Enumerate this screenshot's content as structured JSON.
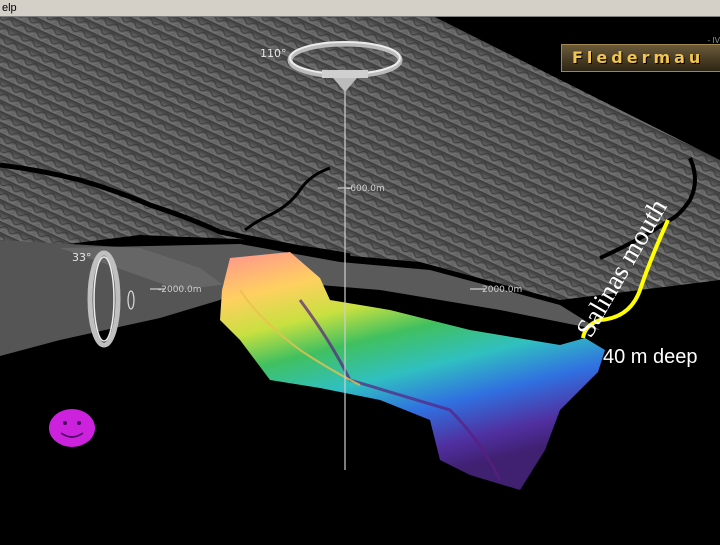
{
  "menu": {
    "help_label": "elp"
  },
  "logo": {
    "text": "Fledermau"
  },
  "compass": {
    "azimuth_label": "110°",
    "tilt_label": "33°"
  },
  "axes": {
    "label_top": "-600.0m",
    "label_left": "-2000.0m",
    "label_right": "2000.0m"
  },
  "annotations": {
    "mouth": "Salinas mouth",
    "depth": "40 m deep"
  },
  "colors": {
    "annotation_line": "#ffff00",
    "smiley": "#cc22dd"
  }
}
